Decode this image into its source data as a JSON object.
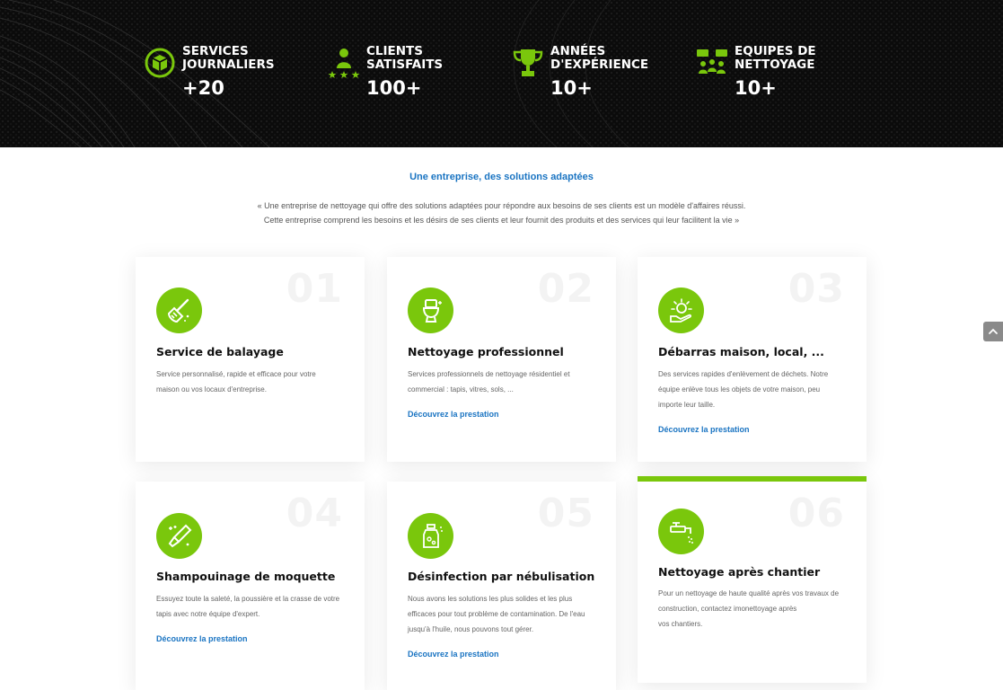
{
  "colors": {
    "accent": "#7ac70c",
    "link": "#1a74c2",
    "hero_bg": "#0b0b0b"
  },
  "stats": [
    {
      "label_line1": "SERVICES",
      "label_line2": "JOURNALIERS",
      "value": "+20",
      "icon": "service-box-icon"
    },
    {
      "label_line1": "CLIENTS",
      "label_line2": "SATISFAITS",
      "value": "100+",
      "icon": "client-stars-icon"
    },
    {
      "label_line1": "ANNÉES",
      "label_line2": "D'EXPÉRIENCE",
      "value": "10+",
      "icon": "trophy-icon"
    },
    {
      "label_line1": "EQUIPES DE",
      "label_line2": "NETTOYAGE",
      "value": "10+",
      "icon": "team-icon"
    }
  ],
  "intro": {
    "title": "Une entreprise, des solutions adaptées",
    "line1": "« Une entreprise de nettoyage qui offre des solutions adaptées pour répondre aux besoins de ses clients est un modèle d'affaires réussi.",
    "line2": "Cette entreprise comprend les besoins et les désirs de ses clients et leur fournit des produits et des services qui leur facilitent la vie »"
  },
  "cards": [
    {
      "number": "01",
      "title": "Service de balayage",
      "icon": "broom-icon",
      "desc_lines": [
        "Service personnalisé, rapide et efficace pour votre",
        "maison ou vos locaux d'entreprise."
      ],
      "link": ""
    },
    {
      "number": "02",
      "title": "Nettoyage professionnel",
      "icon": "toilet-icon",
      "desc_lines": [
        "Services professionnels de nettoyage résidentiel et",
        "commercial : tapis, vitres, sols, ..."
      ],
      "link": "Découvrez la prestation"
    },
    {
      "number": "03",
      "title": "Débarras maison, local, ...",
      "icon": "hand-sparkle-icon",
      "desc_lines": [
        "Des services rapides d'enlèvement de déchets. Notre",
        "équipe enlève tous les objets de votre maison, peu",
        "importe leur taille."
      ],
      "link": "Découvrez la prestation"
    },
    {
      "number": "04",
      "title": "Shampouinage de moquette",
      "icon": "brush-icon",
      "desc_lines": [
        "Essuyez toute la saleté, la poussière et la crasse de votre",
        "tapis avec notre équipe d'expert."
      ],
      "link": "Découvrez la prestation"
    },
    {
      "number": "05",
      "title": "Désinfection par nébulisation",
      "icon": "spray-bottle-icon",
      "desc_lines": [
        "Nous avons les solutions les plus solides et les plus",
        "efficaces pour tout problème de contamination. De l'eau",
        "jusqu'à l'huile, nous pouvons tout gérer."
      ],
      "link": "Découvrez la prestation"
    },
    {
      "number": "06",
      "title": "Nettoyage après chantier",
      "icon": "faucet-icon",
      "desc_lines": [
        "Pour un nettoyage de haute qualité après vos travaux de",
        "construction, contactez imonettoyage après",
        "vos chantiers."
      ],
      "link": ""
    }
  ],
  "scroll_top": {
    "icon": "chevron-up-icon"
  }
}
